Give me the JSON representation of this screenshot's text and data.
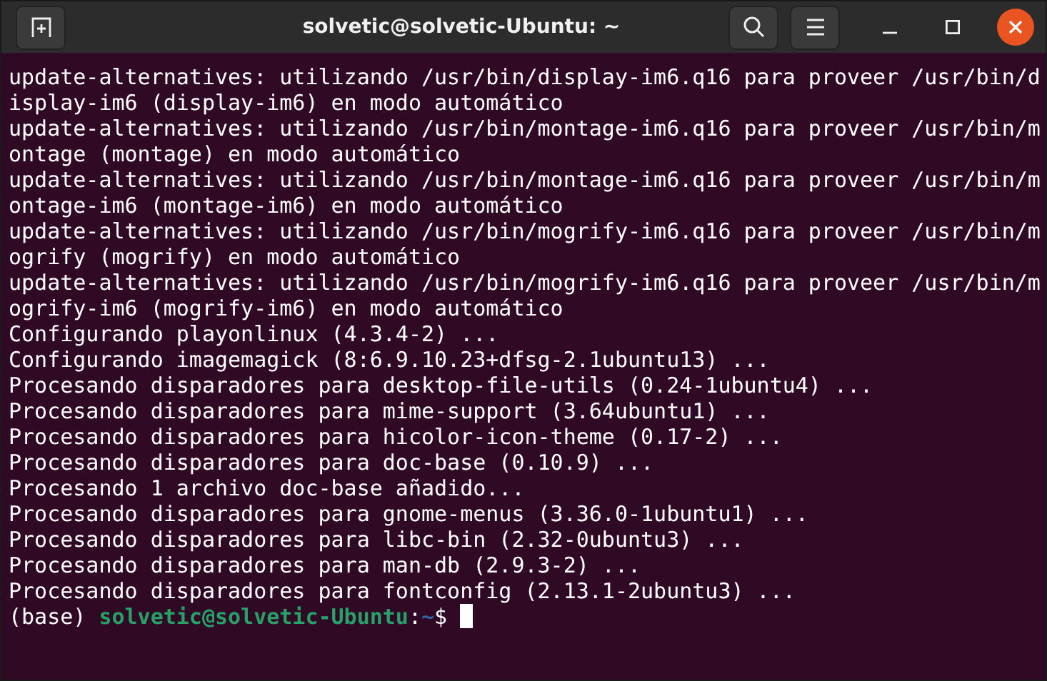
{
  "window": {
    "title": "solvetic@solvetic-Ubuntu: ~"
  },
  "terminal": {
    "lines": [
      "update-alternatives: utilizando /usr/bin/display-im6.q16 para proveer /usr/bin/d",
      "isplay-im6 (display-im6) en modo automático",
      "update-alternatives: utilizando /usr/bin/montage-im6.q16 para proveer /usr/bin/m",
      "ontage (montage) en modo automático",
      "update-alternatives: utilizando /usr/bin/montage-im6.q16 para proveer /usr/bin/m",
      "ontage-im6 (montage-im6) en modo automático",
      "update-alternatives: utilizando /usr/bin/mogrify-im6.q16 para proveer /usr/bin/m",
      "ogrify (mogrify) en modo automático",
      "update-alternatives: utilizando /usr/bin/mogrify-im6.q16 para proveer /usr/bin/m",
      "ogrify-im6 (mogrify-im6) en modo automático",
      "Configurando playonlinux (4.3.4-2) ...",
      "Configurando imagemagick (8:6.9.10.23+dfsg-2.1ubuntu13) ...",
      "Procesando disparadores para desktop-file-utils (0.24-1ubuntu4) ...",
      "Procesando disparadores para mime-support (3.64ubuntu1) ...",
      "Procesando disparadores para hicolor-icon-theme (0.17-2) ...",
      "Procesando disparadores para doc-base (0.10.9) ...",
      "Procesando 1 archivo doc-base añadido...",
      "Procesando disparadores para gnome-menus (3.36.0-1ubuntu1) ...",
      "Procesando disparadores para libc-bin (2.32-0ubuntu3) ...",
      "Procesando disparadores para man-db (2.9.3-2) ...",
      "Procesando disparadores para fontconfig (2.13.1-2ubuntu3) ..."
    ],
    "prompt": {
      "env": "(base)",
      "user_host": "solvetic@solvetic-Ubuntu",
      "separator": ":",
      "path": "~",
      "symbol": "$"
    }
  }
}
